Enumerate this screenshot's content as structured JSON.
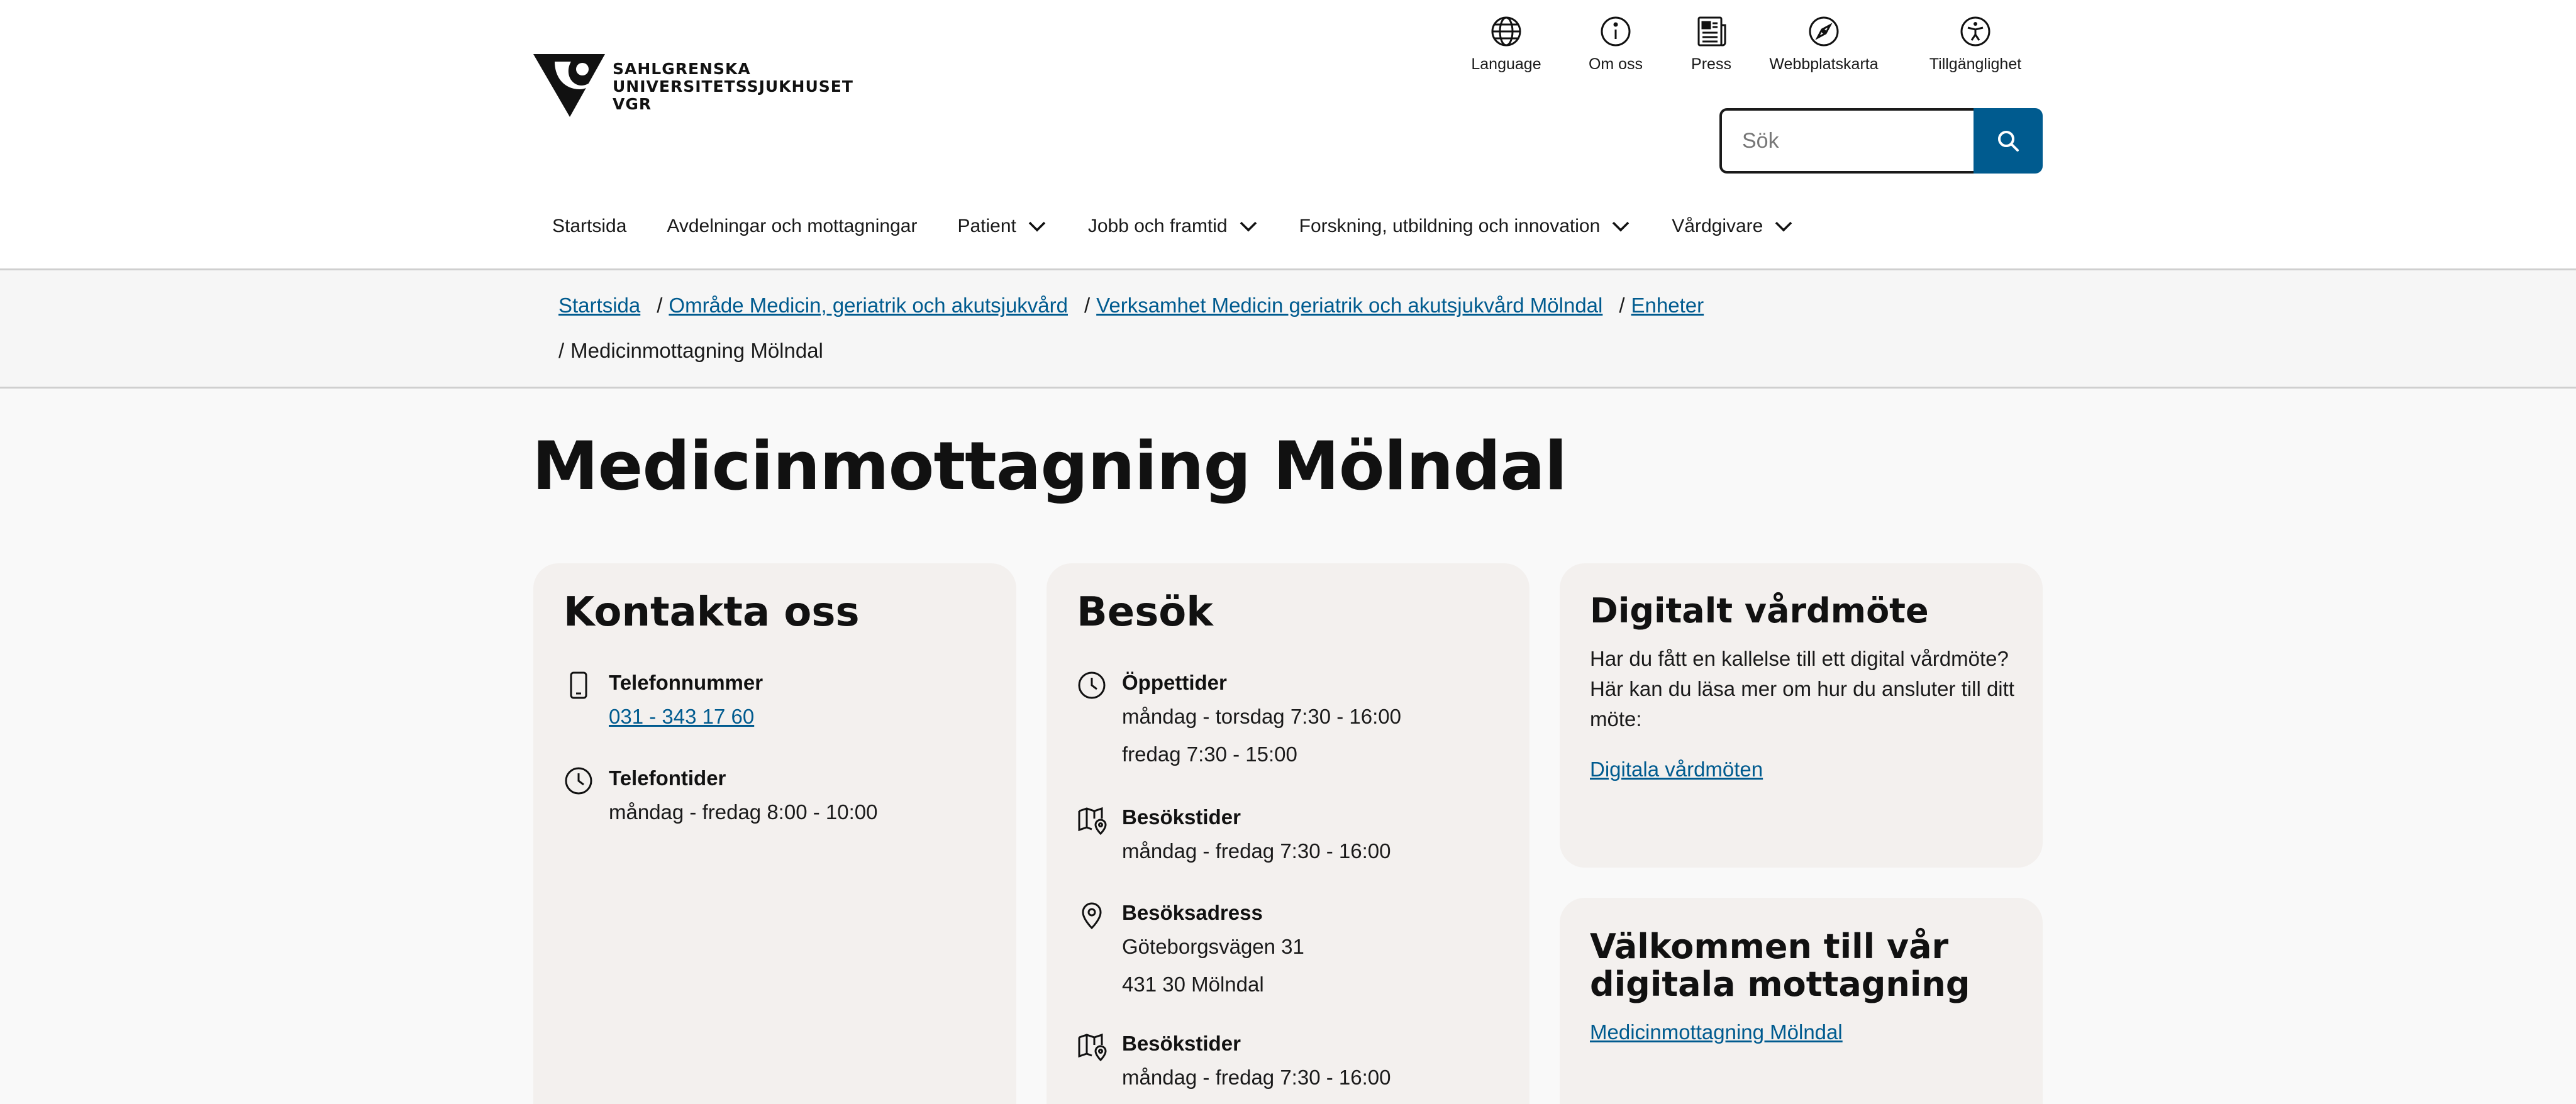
{
  "logo": {
    "line1": "SAHLGRENSKA",
    "line2": "UNIVERSITETSSJUKHUSET",
    "line3": "VGR"
  },
  "utility_nav": [
    {
      "label": "Language",
      "icon": "globe-icon"
    },
    {
      "label": "Om oss",
      "icon": "info-icon"
    },
    {
      "label": "Press",
      "icon": "newspaper-icon"
    },
    {
      "label": "Webbplatskarta",
      "icon": "compass-icon"
    },
    {
      "label": "Tillgänglighet",
      "icon": "accessibility-icon"
    }
  ],
  "search": {
    "placeholder": "Sök",
    "value": ""
  },
  "main_nav": [
    {
      "label": "Startsida"
    },
    {
      "label": "Avdelningar och mottagningar"
    },
    {
      "label": "Patient"
    },
    {
      "label": "Jobb och framtid"
    },
    {
      "label": "Forskning, utbildning och innovation"
    },
    {
      "label": "Vårdgivare"
    }
  ],
  "breadcrumb": {
    "items": [
      "Startsida",
      "Område Medicin, geriatrik och akutsjukvård",
      "Verksamhet Medicin geriatrik och akutsjukvård Mölndal",
      "Enheter"
    ],
    "separator": "/",
    "current": "Medicinmottagning Mölndal"
  },
  "page_title": "Medicinmottagning Mölndal",
  "contact": {
    "title": "Kontakta oss",
    "phone_label": "Telefonnummer",
    "phone_value": "031 - 343 17 60",
    "hours_label": "Telefontider",
    "hours_value": "måndag - fredag 8:00 - 10:00"
  },
  "visit": {
    "title": "Besök",
    "opening_label": "Öppettider",
    "opening_line1": "måndag - torsdag 7:30 - 16:00",
    "opening_line2": "fredag 7:30 - 15:00",
    "visiting_label": "Besökstider",
    "visiting_value": "måndag - fredag 7:30 - 16:00",
    "address_label": "Besöksadress",
    "address_line1": "Göteborgsvägen 31",
    "address_line2": "431 30 Mölndal",
    "visiting2_label": "Besökstider",
    "visiting2_value": "måndag - fredag 7:30 - 16:00"
  },
  "digital": {
    "title": "Digitalt vårdmöte",
    "text": "Har du fått en kallelse till ett digital vårdmöte? Här kan du läsa mer om hur du ansluter till ditt möte:",
    "link": "Digitala vårdmöten"
  },
  "welcome": {
    "title_line1": "Välkommen till vår",
    "title_line2": "digitala mottagning",
    "link": "Medicinmottagning Mölndal"
  },
  "colors": {
    "link": "#005b8f",
    "search_button": "#005b8f",
    "card_background": "#f3f0ee",
    "page_background": "#f9f9f9"
  }
}
